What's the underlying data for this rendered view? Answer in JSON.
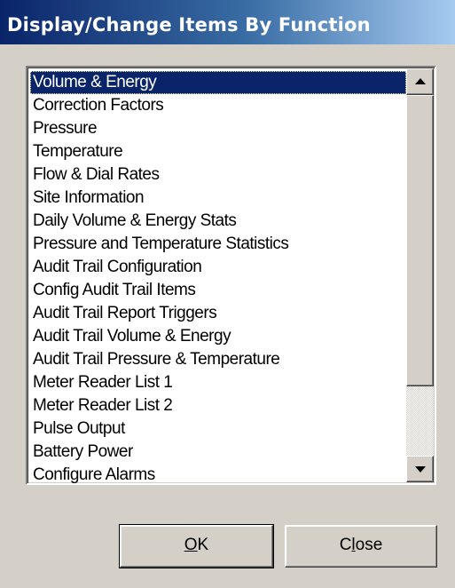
{
  "window": {
    "title": "Display/Change Items By Function"
  },
  "list": {
    "selected_index": 0,
    "items": [
      "Volume & Energy",
      "Correction Factors",
      "Pressure",
      "Temperature",
      "Flow & Dial Rates",
      "Site Information",
      "Daily Volume & Energy Stats",
      "Pressure and Temperature Statistics",
      "Audit Trail Configuration",
      "Config Audit Trail Items",
      "Audit Trail Report Triggers",
      "Audit Trail Volume & Energy",
      "Audit Trail Pressure & Temperature",
      "Meter Reader List 1",
      "Meter Reader List 2",
      "Pulse Output",
      "Battery Power",
      "Configure Alarms"
    ]
  },
  "buttons": {
    "ok": {
      "mnemonic": "O",
      "rest": "K"
    },
    "close": {
      "before": "C",
      "mnemonic": "l",
      "after": "ose"
    }
  },
  "colors": {
    "selection": "#0a246a",
    "face": "#d4d0c8"
  }
}
